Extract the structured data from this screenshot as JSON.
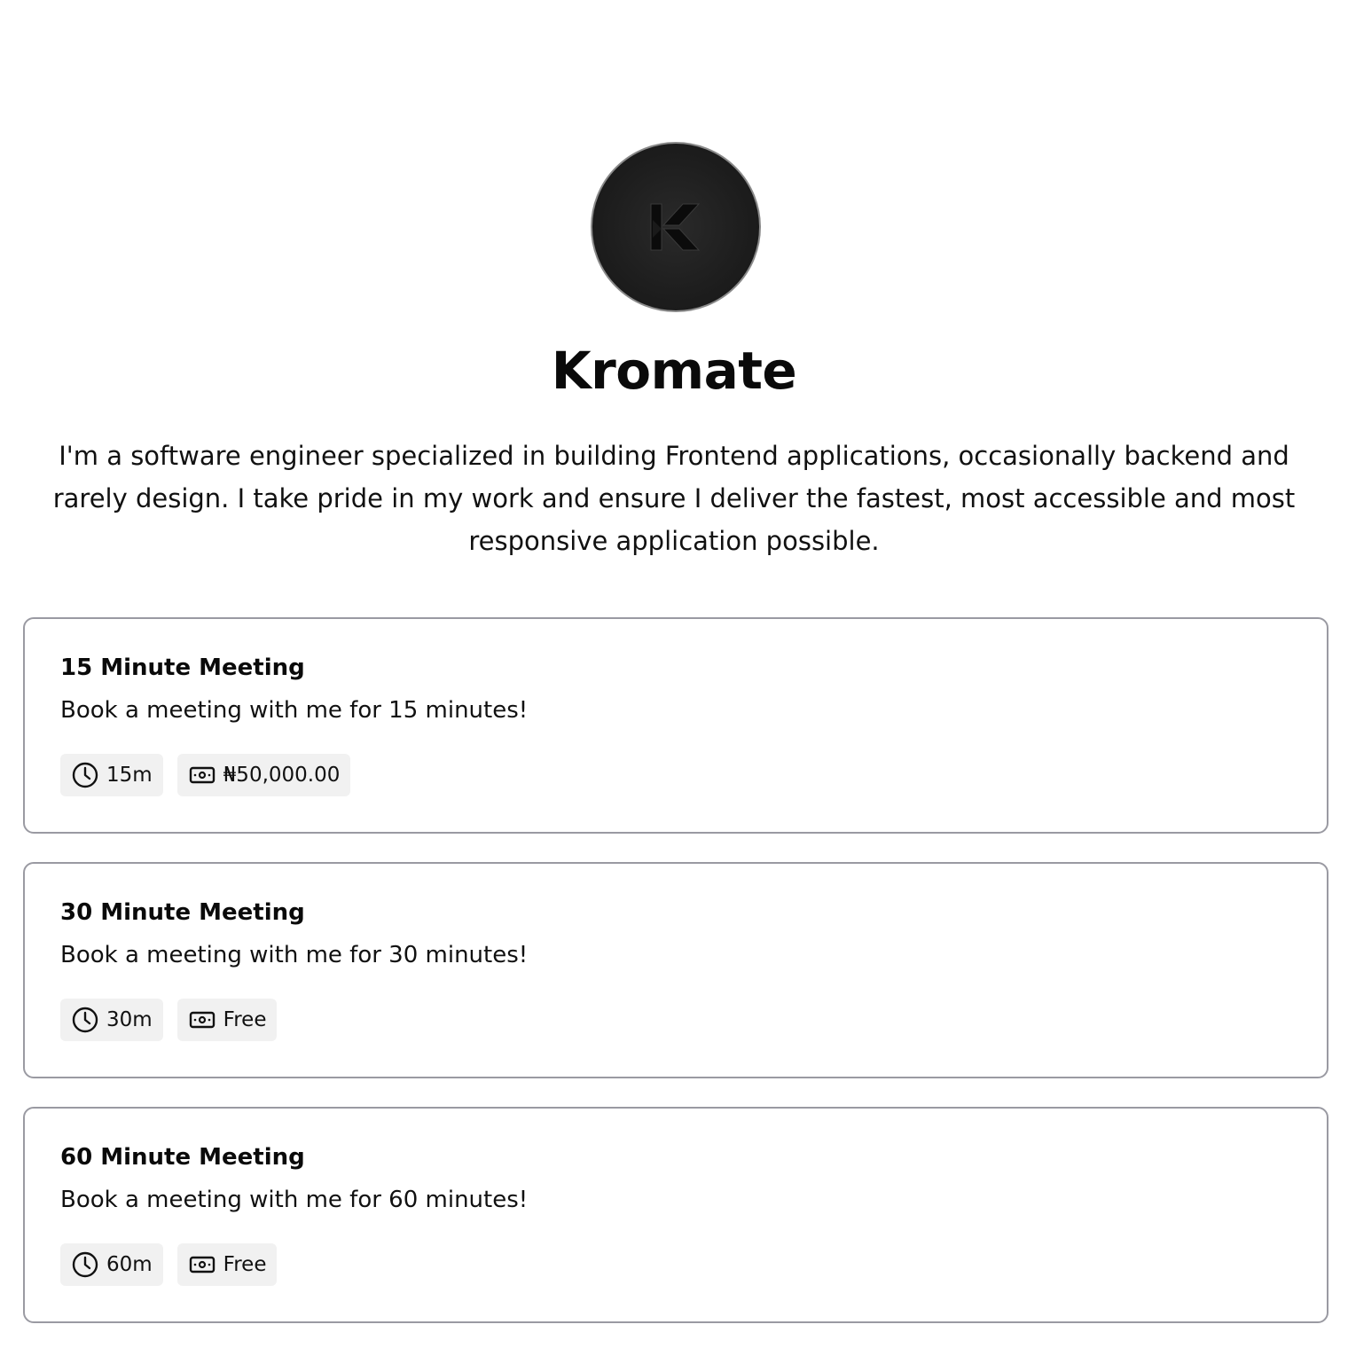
{
  "profile": {
    "name": "Kromate",
    "bio": "I'm a software engineer specialized in building Frontend applications, occasionally backend and rarely design. I take pride in my work and ensure I deliver the fastest, most accessible and most responsive application possible.",
    "avatar_icon": "k-logo-icon"
  },
  "events": [
    {
      "title": "15 Minute Meeting",
      "description": "Book a meeting with me for 15 minutes!",
      "duration": "15m",
      "price": "₦50,000.00"
    },
    {
      "title": "30 Minute Meeting",
      "description": "Book a meeting with me for 30 minutes!",
      "duration": "30m",
      "price": "Free"
    },
    {
      "title": "60 Minute Meeting",
      "description": "Book a meeting with me for 60 minutes!",
      "duration": "60m",
      "price": "Free"
    }
  ],
  "icons": {
    "duration": "clock-icon",
    "price": "money-icon"
  },
  "colors": {
    "card_border": "#9a9aa2",
    "badge_bg": "#f1f1f1",
    "avatar_bg": "#1e1e1e"
  }
}
